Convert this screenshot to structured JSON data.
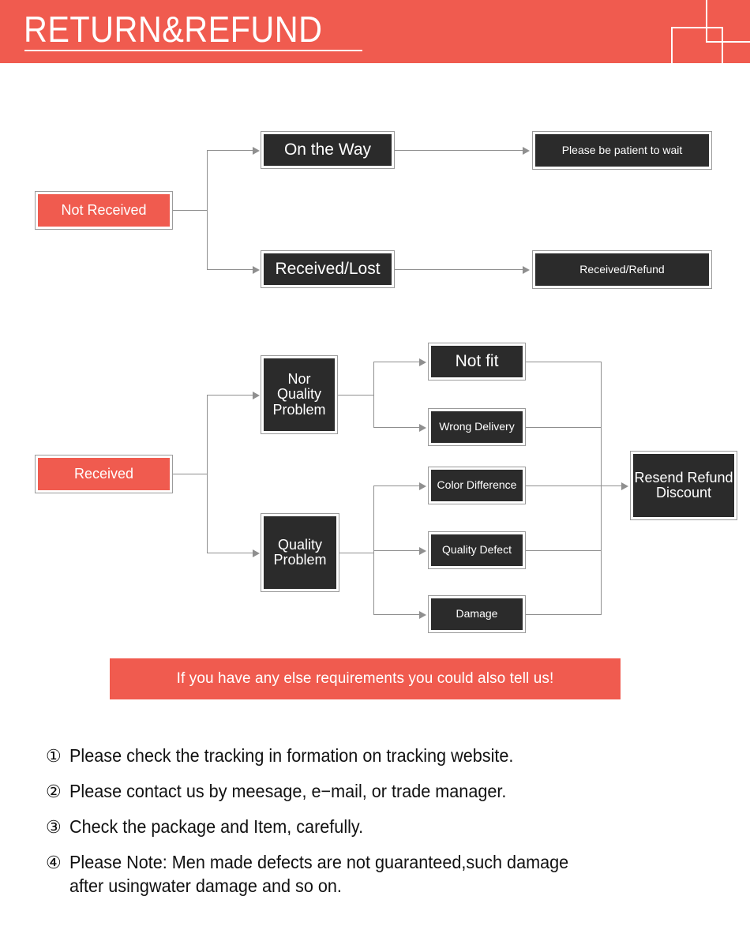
{
  "header": {
    "title": "RETURN&REFUND",
    "background_color": "#F05B4F",
    "text_color": "#FFFFFF"
  },
  "colors": {
    "accent_red": "#F05B4F",
    "box_dark": "#2B2B2B",
    "connector_gray": "#8F8F8F",
    "box_border_gray": "#9B9B9B"
  },
  "flow_not_received": {
    "root": "Not Received",
    "branches": [
      {
        "status": "On the Way",
        "action": "Please be patient to wait"
      },
      {
        "status": "Received/Lost",
        "action": "Received/Refund"
      }
    ]
  },
  "flow_received": {
    "root": "Received",
    "categories": [
      {
        "name": "Nor Quality Problem",
        "reasons": [
          "Not fit",
          "Wrong Delivery"
        ]
      },
      {
        "name": "Quality Problem",
        "reasons": [
          "Color Difference",
          "Quality Defect",
          "Damage"
        ]
      }
    ],
    "outcome": "Resend Refund Discount"
  },
  "banner": {
    "text": "If you have any else requirements you could also tell us!"
  },
  "notes": [
    {
      "num": "①",
      "text": "Please check the tracking in formation on tracking website."
    },
    {
      "num": "②",
      "text": "Please contact us by meesage, e−mail, or trade manager."
    },
    {
      "num": "③",
      "text": "Check the package and Item, carefully."
    },
    {
      "num": "④",
      "text": "Please Note: Men made defects are not guaranteed,such damage\nafter usingwater damage and so on."
    }
  ]
}
